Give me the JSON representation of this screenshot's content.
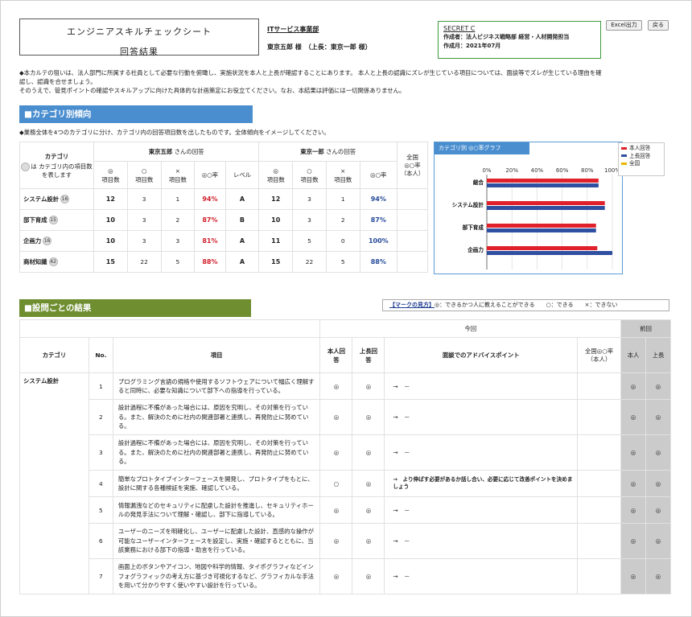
{
  "header": {
    "title_line1": "エンジニアスキルチェックシート",
    "title_line2": "回答結果",
    "dept": "ITサービス事業部",
    "names": "東京五郎 様　（上長：東京一郎 様）",
    "secret": "SECRET C",
    "author": "作成者：法人ビジネス戦略部 経営・人材開発担当",
    "created": "作成月：2021年07月",
    "btn_excel": "Excel出力",
    "btn_back": "戻る"
  },
  "intro": [
    "◆本カルテの狙いは、法人部門に所属する社員として必要な行動を俯瞰し、実施状況を本人と上長が確認することにあります。 本人と上長の認識にズレが生じている項目については、面談等でズレが生じている理由を確",
    "認し、認識を合せましょう。",
    "そのうえで、管見ポイントの確認やスキルアップに向けた具体的な計画策定にお役立てください。なお、本結果は評価には一切関係ありません。"
  ],
  "category_section": {
    "title": "■カテゴリ別傾向",
    "desc": "◆業務全体を4つのカテゴリに分け、カテゴリ内の回答項目数を出したものです。全体傾向をイメージしてください。",
    "head": {
      "category": "カテゴリ",
      "cat_note": "は カテゴリ内の項目数を表します",
      "self_label": "東京五郎",
      "boss_label": "東京一郎",
      "answer_suffix": " さんの回答",
      "col_ee": "◎",
      "col_o": "○",
      "col_x": "×",
      "col_items": "項目数",
      "col_rate": "◎○率",
      "col_level": "レベル",
      "company": "全国",
      "company2": "◎○率",
      "company3": "（本人）"
    },
    "rows": [
      {
        "name": "システム設計",
        "count": "16",
        "s_ee": "12",
        "s_o": "3",
        "s_x": "1",
        "s_rate": "94%",
        "level": "A",
        "b_ee": "12",
        "b_o": "3",
        "b_x": "1",
        "b_rate": "94%"
      },
      {
        "name": "部下育成",
        "count": "15",
        "s_ee": "10",
        "s_o": "3",
        "s_x": "2",
        "s_rate": "87%",
        "level": "B",
        "b_ee": "10",
        "b_o": "3",
        "b_x": "2",
        "b_rate": "87%"
      },
      {
        "name": "企画力",
        "count": "16",
        "s_ee": "10",
        "s_o": "3",
        "s_x": "3",
        "s_rate": "81%",
        "level": "A",
        "b_ee": "11",
        "b_o": "5",
        "b_x": "0",
        "b_rate": "100%"
      },
      {
        "name": "商材知識",
        "count": "42",
        "s_ee": "15",
        "s_o": "22",
        "s_x": "5",
        "s_rate": "88%",
        "level": "A",
        "b_ee": "15",
        "b_o": "22",
        "b_x": "5",
        "b_rate": "88%"
      }
    ]
  },
  "chart_data": {
    "type": "bar",
    "title": "カテゴリ別 ◎○率グラフ",
    "categories": [
      "総合",
      "システム設計",
      "部下育成",
      "企画力"
    ],
    "series": [
      {
        "name": "本人回答",
        "values": [
          89,
          94,
          87,
          88
        ],
        "color": "#e0202a"
      },
      {
        "name": "上長回答",
        "values": [
          89,
          94,
          87,
          100
        ],
        "color": "#2f4fa0"
      },
      {
        "name": "全国",
        "values": [],
        "color": "#e8b800"
      }
    ],
    "xlim": [
      0,
      100
    ],
    "ticks": [
      "0%",
      "20%",
      "40%",
      "60%",
      "80%",
      "100%"
    ],
    "grid": true,
    "legend": "top-right"
  },
  "detail_section": {
    "title": "■設問ごとの結果",
    "mark_label": "【マークの見方】",
    "mark_text": "◎：できるかつ人に教えることができる　　○：できる　　×：できない",
    "head": {
      "now": "今回",
      "prev": "前回",
      "category": "カテゴリ",
      "no": "No.",
      "item": "項目",
      "self": "本人回答",
      "boss": "上長回答",
      "advice": "面談でのアドバイスポイント",
      "company": "全国◎○率（本人）",
      "p_self": "本人",
      "p_boss": "上長"
    },
    "category_name": "システム設計",
    "rows": [
      {
        "no": "1",
        "text": "プログラミング言語の規格や使用するソフトウェアについて幅広く理解すると同時に、必要な知識について部下への指導を行っている。",
        "self": "◎",
        "boss": "◎",
        "advice": "→　－",
        "bold": false,
        "p_self": "◎",
        "p_boss": "◎"
      },
      {
        "no": "2",
        "text": "設計過程に不備があった場合には、原因を究明し、その対策を行っている。また、解決のために社内の関連部署と連携し、再発防止に努めている。",
        "self": "◎",
        "boss": "◎",
        "advice": "→　－",
        "bold": false,
        "p_self": "◎",
        "p_boss": "◎"
      },
      {
        "no": "3",
        "text": "設計過程に不備があった場合には、原因を究明し、その対策を行っている。また、解決のために社内の関連部署と連携し、再発防止に努めている。",
        "self": "◎",
        "boss": "◎",
        "advice": "→　－",
        "bold": false,
        "p_self": "◎",
        "p_boss": "◎"
      },
      {
        "no": "4",
        "text": "簡単なプロトタイプインターフェースを開発し、プロトタイプをもとに、設計に関する各種検証を実施、確認している。",
        "self": "○",
        "boss": "◎",
        "advice": "→　より伸ばす必要があるか話し合い、必要に応じて改善ポイントを決めましょう",
        "bold": true,
        "p_self": "◎",
        "p_boss": "◎"
      },
      {
        "no": "5",
        "text": "情報漏洩などのセキュリティに配慮した設計を推進し、セキュリティホールの発見手法について理解・確認し、部下に指導している。",
        "self": "◎",
        "boss": "◎",
        "advice": "→　－",
        "bold": false,
        "p_self": "◎",
        "p_boss": "◎"
      },
      {
        "no": "6",
        "text": "ユーザーのニーズを明確化し、ユーザーに配慮した設計、直感的な操作が可能なユーザーインターフェースを設定し、実施・確認するとともに、当該業務における部下の指導・助言を行っている。",
        "self": "◎",
        "boss": "◎",
        "advice": "→　－",
        "bold": false,
        "p_self": "◎",
        "p_boss": "◎"
      },
      {
        "no": "7",
        "text": "画面上のボタンやアイコン、地図や科学的情報、タイポグラフィなどインフォグラフィックの考え方に基づき可視化するなど、グラフィカルな手法を用いて分かりやすく使いやすい設計を行っている。",
        "self": "◎",
        "boss": "◎",
        "advice": "→　－",
        "bold": false,
        "p_self": "◎",
        "p_boss": "◎"
      }
    ]
  }
}
